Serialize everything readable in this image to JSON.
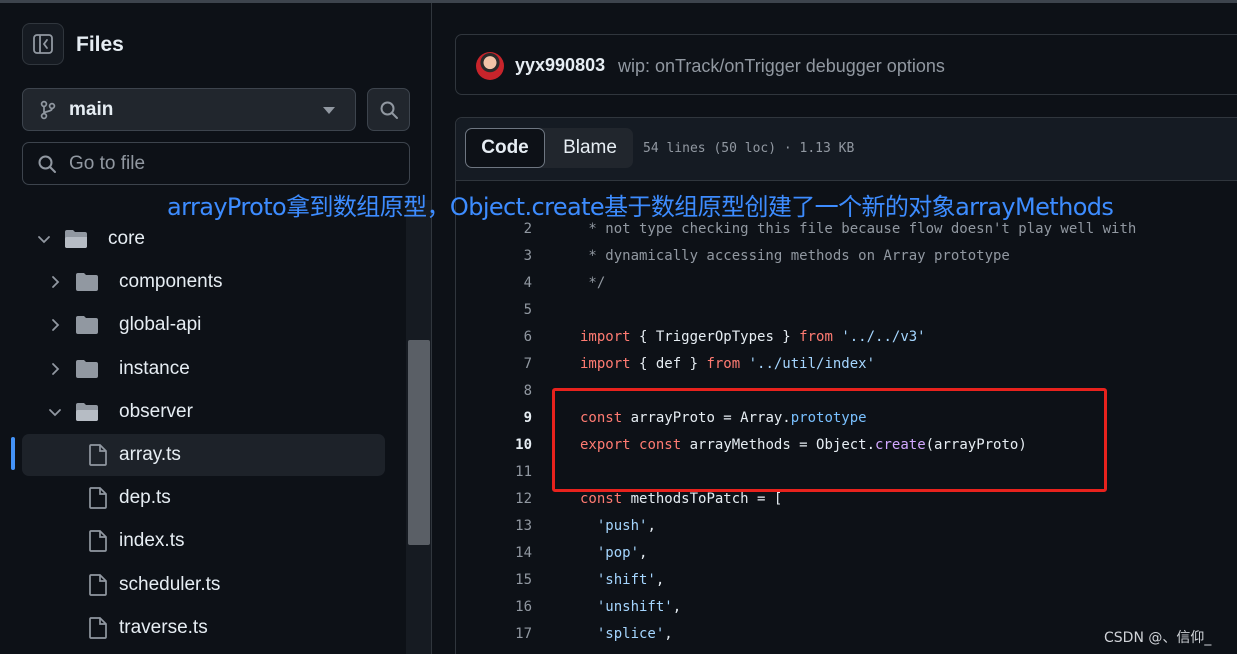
{
  "sidebar": {
    "title": "Files",
    "branch": "main",
    "goto_placeholder": "Go to file",
    "tree": [
      {
        "label": "core",
        "type": "folder",
        "expanded": true
      },
      {
        "label": "components",
        "type": "folder",
        "expanded": false
      },
      {
        "label": "global-api",
        "type": "folder",
        "expanded": false
      },
      {
        "label": "instance",
        "type": "folder",
        "expanded": false
      },
      {
        "label": "observer",
        "type": "folder",
        "expanded": true
      },
      {
        "label": "array.ts",
        "type": "file",
        "selected": true
      },
      {
        "label": "dep.ts",
        "type": "file"
      },
      {
        "label": "index.ts",
        "type": "file"
      },
      {
        "label": "scheduler.ts",
        "type": "file"
      },
      {
        "label": "traverse.ts",
        "type": "file"
      }
    ]
  },
  "commit": {
    "author": "yyx990803",
    "message": "wip: onTrack/onTrigger debugger options"
  },
  "viewer": {
    "tab_code": "Code",
    "tab_blame": "Blame",
    "meta": "54 lines (50 loc) · 1.13 KB"
  },
  "code_lines": [
    {
      "n": "2",
      "text": " * not type checking this file because flow doesn't play well with"
    },
    {
      "n": "3",
      "text": " * dynamically accessing methods on Array prototype"
    },
    {
      "n": "4",
      "text": " */"
    },
    {
      "n": "5",
      "text": ""
    },
    {
      "n": "6",
      "text": "import { TriggerOpTypes } from '../../v3'"
    },
    {
      "n": "7",
      "text": "import { def } from '../util/index'"
    },
    {
      "n": "8",
      "text": ""
    },
    {
      "n": "9",
      "text": "const arrayProto = Array.prototype"
    },
    {
      "n": "10",
      "text": "export const arrayMethods = Object.create(arrayProto)"
    },
    {
      "n": "11",
      "text": ""
    },
    {
      "n": "12",
      "text": "const methodsToPatch = ["
    },
    {
      "n": "13",
      "text": "  'push',"
    },
    {
      "n": "14",
      "text": "  'pop',"
    },
    {
      "n": "15",
      "text": "  'shift',"
    },
    {
      "n": "16",
      "text": "  'unshift',"
    },
    {
      "n": "17",
      "text": "  'splice',"
    }
  ],
  "annotation": "arrayProto拿到数组原型，Object.create基于数组原型创建了一个新的对象arrayMethods",
  "watermark": "CSDN @、信仰_",
  "colors": {
    "background": "#0d1117",
    "keyword": "#ff7b72",
    "string": "#a5d6ff",
    "function": "#d2a8ff",
    "constant": "#79c0ff",
    "annotation": "#3d8cff",
    "highlight_box": "#e8221d",
    "active_indicator": "#4493f8"
  },
  "icons": {
    "panel_toggle": "sidebar-collapse-icon",
    "branch": "git-branch-icon",
    "search": "search-icon",
    "folder": "folder-icon",
    "file": "file-icon",
    "chevron_right": "chevron-right-icon",
    "chevron_down": "chevron-down-icon"
  }
}
